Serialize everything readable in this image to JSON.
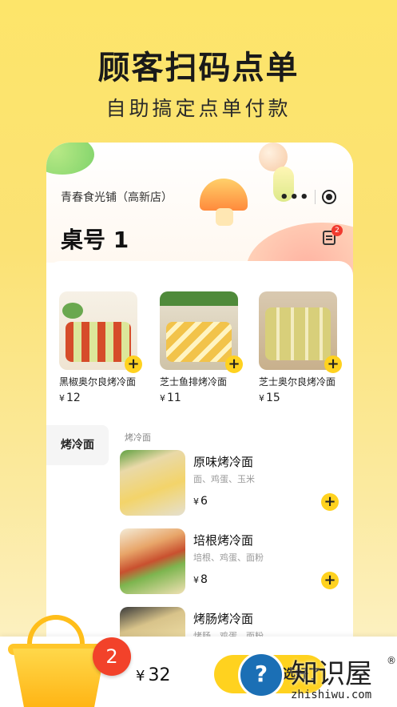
{
  "hero": {
    "title": "顾客扫码点单",
    "subtitle": "自助搞定点单付款"
  },
  "header": {
    "store_name": "青春食光铺（高新店）",
    "menu_dots": "•••",
    "table_label": "桌号 1",
    "order_badge": "2"
  },
  "recommended": [
    {
      "name": "黑椒奥尔良烤冷面",
      "price": "12",
      "currency": "¥",
      "add": "+"
    },
    {
      "name": "芝士鱼排烤冷面",
      "price": "11",
      "currency": "¥",
      "add": "+"
    },
    {
      "name": "芝士奥尔良烤冷面",
      "price": "15",
      "currency": "¥",
      "add": "+"
    }
  ],
  "categories": {
    "active": "烤冷面",
    "heading": "烤冷面"
  },
  "dishes": [
    {
      "name": "原味烤冷面",
      "desc": "面、鸡蛋、玉米",
      "price": "6",
      "currency": "¥",
      "add": "+"
    },
    {
      "name": "培根烤冷面",
      "desc": "培根、鸡蛋、面粉",
      "price": "8",
      "currency": "¥",
      "add": "+"
    },
    {
      "name": "烤肠烤冷面",
      "desc": "烤肠、鸡蛋、面粉",
      "price": "",
      "currency": "",
      "add": "+"
    }
  ],
  "cart": {
    "count": "2",
    "currency": "¥",
    "total": "32",
    "checkout_label": "选好了"
  },
  "watermark": {
    "text": "知识屋",
    "reg": "®",
    "url": "zhishiwu.com"
  },
  "colors": {
    "accent": "#ffd21f",
    "badge": "#f03a2f",
    "background": "#fde56a"
  }
}
